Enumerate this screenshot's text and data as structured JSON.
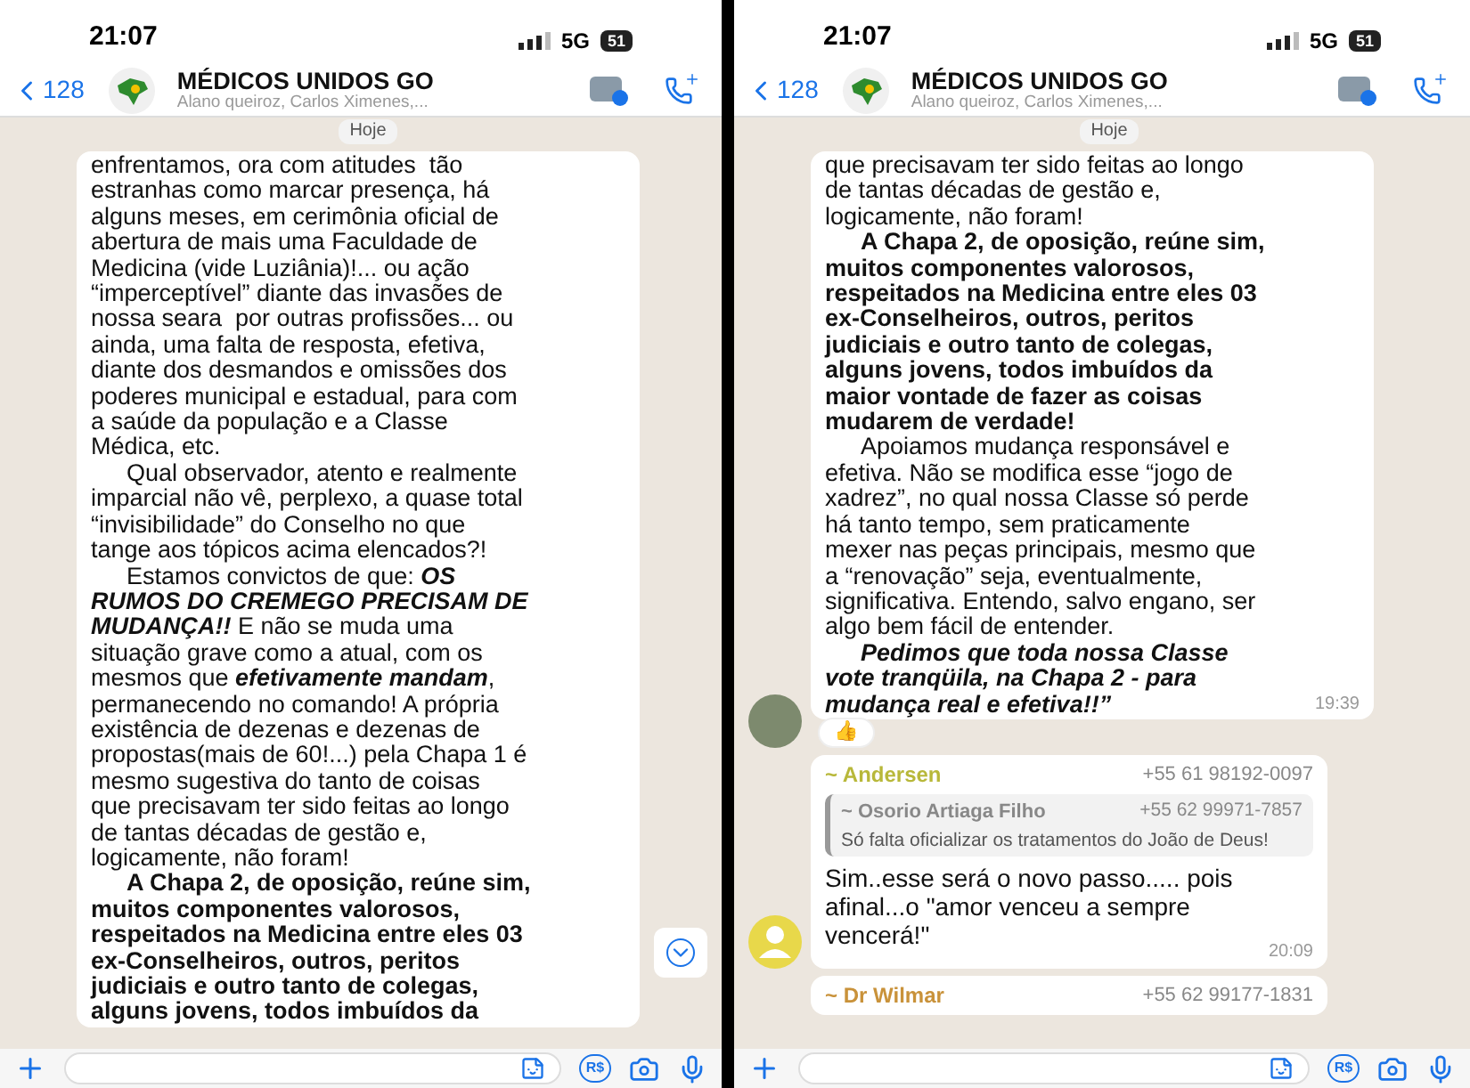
{
  "panels": [
    {
      "status": {
        "time": "21:07",
        "network": "5G",
        "battery": "51"
      },
      "header": {
        "back_count": "128",
        "title": "MÉDICOS UNIDOS GO",
        "subtitle": "Alano queiroz, Carlos Ximenes,..."
      },
      "date_chip": "Hoje",
      "messages": [
        {
          "kind": "long_text",
          "lines": [
            {
              "indent": false,
              "parts": [
                {
                  "text": "enfrentamos, ora com atitudes  tão",
                  "kind": "plain"
                }
              ]
            },
            {
              "indent": false,
              "parts": [
                {
                  "text": "estranhas como marcar presença, há",
                  "kind": "plain"
                }
              ]
            },
            {
              "indent": false,
              "parts": [
                {
                  "text": "alguns meses, em cerimônia oficial de",
                  "kind": "plain"
                }
              ]
            },
            {
              "indent": false,
              "parts": [
                {
                  "text": "abertura de mais uma Faculdade de",
                  "kind": "plain"
                }
              ]
            },
            {
              "indent": false,
              "parts": [
                {
                  "text": "Medicina (vide Luziânia)!... ou ação",
                  "kind": "plain"
                }
              ]
            },
            {
              "indent": false,
              "parts": [
                {
                  "text": "“imperceptível” diante das invasões de",
                  "kind": "plain"
                }
              ]
            },
            {
              "indent": false,
              "parts": [
                {
                  "text": "nossa seara  por outras profissões... ou",
                  "kind": "plain"
                }
              ]
            },
            {
              "indent": false,
              "parts": [
                {
                  "text": "ainda, uma falta de resposta, efetiva,",
                  "kind": "plain"
                }
              ]
            },
            {
              "indent": false,
              "parts": [
                {
                  "text": "diante dos desmandos e omissões dos",
                  "kind": "plain"
                }
              ]
            },
            {
              "indent": false,
              "parts": [
                {
                  "text": "poderes municipal e estadual, para com",
                  "kind": "plain"
                }
              ]
            },
            {
              "indent": false,
              "parts": [
                {
                  "text": "a saúde da população e a Classe",
                  "kind": "plain"
                }
              ]
            },
            {
              "indent": false,
              "parts": [
                {
                  "text": "Médica, etc.",
                  "kind": "plain"
                }
              ]
            },
            {
              "indent": true,
              "parts": [
                {
                  "text": "Qual observador, atento e realmente",
                  "kind": "plain"
                }
              ]
            },
            {
              "indent": false,
              "parts": [
                {
                  "text": "imparcial não vê, perplexo, a quase total",
                  "kind": "plain"
                }
              ]
            },
            {
              "indent": false,
              "parts": [
                {
                  "text": "“invisibilidade” do Conselho no que",
                  "kind": "plain"
                }
              ]
            },
            {
              "indent": false,
              "parts": [
                {
                  "text": "tange aos tópicos acima elencados?!",
                  "kind": "plain"
                }
              ]
            },
            {
              "indent": true,
              "parts": [
                {
                  "text": "Estamos convictos de que: ",
                  "kind": "plain"
                },
                {
                  "text": "OS",
                  "kind": "bold_italic"
                }
              ]
            },
            {
              "indent": false,
              "parts": [
                {
                  "text": "RUMOS DO CREMEGO PRECISAM DE",
                  "kind": "bold_italic"
                }
              ]
            },
            {
              "indent": false,
              "parts": [
                {
                  "text": "MUDANÇA!!",
                  "kind": "bold_italic"
                },
                {
                  "text": " E não se muda uma",
                  "kind": "plain"
                }
              ]
            },
            {
              "indent": false,
              "parts": [
                {
                  "text": "situação grave como a atual, com os",
                  "kind": "plain"
                }
              ]
            },
            {
              "indent": false,
              "parts": [
                {
                  "text": "mesmos que ",
                  "kind": "plain"
                },
                {
                  "text": "efetivamente mandam",
                  "kind": "bold_italic"
                },
                {
                  "text": ",",
                  "kind": "plain"
                }
              ]
            },
            {
              "indent": false,
              "parts": [
                {
                  "text": "permanecendo no comando! A própria",
                  "kind": "plain"
                }
              ]
            },
            {
              "indent": false,
              "parts": [
                {
                  "text": "existência de dezenas e dezenas de",
                  "kind": "plain"
                }
              ]
            },
            {
              "indent": false,
              "parts": [
                {
                  "text": "propostas(mais de 60!...) pela Chapa 1 é",
                  "kind": "plain"
                }
              ]
            },
            {
              "indent": false,
              "parts": [
                {
                  "text": "mesmo sugestiva do tanto de coisas",
                  "kind": "plain"
                }
              ]
            },
            {
              "indent": false,
              "parts": [
                {
                  "text": "que precisavam ter sido feitas ao longo",
                  "kind": "plain"
                }
              ]
            },
            {
              "indent": false,
              "parts": [
                {
                  "text": "de tantas décadas de gestão e,",
                  "kind": "plain"
                }
              ]
            },
            {
              "indent": false,
              "parts": [
                {
                  "text": "logicamente, não foram!",
                  "kind": "plain"
                }
              ]
            },
            {
              "indent": true,
              "parts": [
                {
                  "text": "A Chapa 2, de oposição, reúne sim,",
                  "kind": "bold"
                }
              ]
            },
            {
              "indent": false,
              "parts": [
                {
                  "text": "muitos componentes valorosos,",
                  "kind": "bold"
                }
              ]
            },
            {
              "indent": false,
              "parts": [
                {
                  "text": "respeitados na Medicina entre eles 03",
                  "kind": "bold"
                }
              ]
            },
            {
              "indent": false,
              "parts": [
                {
                  "text": "ex-Conselheiros, outros, peritos",
                  "kind": "bold"
                }
              ]
            },
            {
              "indent": false,
              "parts": [
                {
                  "text": "judiciais e outro tanto de colegas,",
                  "kind": "bold"
                }
              ]
            },
            {
              "indent": false,
              "parts": [
                {
                  "text": "alguns jovens, todos imbuídos da",
                  "kind": "bold"
                }
              ]
            }
          ]
        }
      ],
      "scroll_down_button": true,
      "bottom_bar": {
        "payment_label": "R$"
      }
    },
    {
      "status": {
        "time": "21:07",
        "network": "5G",
        "battery": "51"
      },
      "header": {
        "back_count": "128",
        "title": "MÉDICOS UNIDOS GO",
        "subtitle": "Alano queiroz, Carlos Ximenes,..."
      },
      "date_chip": "Hoje",
      "messages": [
        {
          "kind": "long_text",
          "avatar": {
            "kind": "photo"
          },
          "time": "19:39",
          "reaction": "👍",
          "lines": [
            {
              "indent": false,
              "parts": [
                {
                  "text": "que precisavam ter sido feitas ao longo",
                  "kind": "plain"
                }
              ]
            },
            {
              "indent": false,
              "parts": [
                {
                  "text": "de tantas décadas de gestão e,",
                  "kind": "plain"
                }
              ]
            },
            {
              "indent": false,
              "parts": [
                {
                  "text": "logicamente, não foram!",
                  "kind": "plain"
                }
              ]
            },
            {
              "indent": true,
              "parts": [
                {
                  "text": "A Chapa 2, de oposição, reúne sim,",
                  "kind": "bold"
                }
              ]
            },
            {
              "indent": false,
              "parts": [
                {
                  "text": "muitos componentes valorosos,",
                  "kind": "bold"
                }
              ]
            },
            {
              "indent": false,
              "parts": [
                {
                  "text": "respeitados na Medicina entre eles 03",
                  "kind": "bold"
                }
              ]
            },
            {
              "indent": false,
              "parts": [
                {
                  "text": "ex-Conselheiros, outros, peritos",
                  "kind": "bold"
                }
              ]
            },
            {
              "indent": false,
              "parts": [
                {
                  "text": "judiciais e outro tanto de colegas,",
                  "kind": "bold"
                }
              ]
            },
            {
              "indent": false,
              "parts": [
                {
                  "text": "alguns jovens, todos imbuídos da",
                  "kind": "bold"
                }
              ]
            },
            {
              "indent": false,
              "parts": [
                {
                  "text": "maior vontade de fazer as coisas",
                  "kind": "bold"
                }
              ]
            },
            {
              "indent": false,
              "parts": [
                {
                  "text": "mudarem de verdade!",
                  "kind": "bold"
                }
              ]
            },
            {
              "indent": true,
              "parts": [
                {
                  "text": "Apoiamos mudança responsável e",
                  "kind": "plain"
                }
              ]
            },
            {
              "indent": false,
              "parts": [
                {
                  "text": "efetiva. Não se modifica esse “jogo de",
                  "kind": "plain"
                }
              ]
            },
            {
              "indent": false,
              "parts": [
                {
                  "text": "xadrez”, no qual nossa Classe só perde",
                  "kind": "plain"
                }
              ]
            },
            {
              "indent": false,
              "parts": [
                {
                  "text": "há tanto tempo, sem praticamente",
                  "kind": "plain"
                }
              ]
            },
            {
              "indent": false,
              "parts": [
                {
                  "text": "mexer nas peças principais, mesmo que",
                  "kind": "plain"
                }
              ]
            },
            {
              "indent": false,
              "parts": [
                {
                  "text": "a “renovação” seja, eventualmente,",
                  "kind": "plain"
                }
              ]
            },
            {
              "indent": false,
              "parts": [
                {
                  "text": "significativa. Entendo, salvo engano, ser",
                  "kind": "plain"
                }
              ]
            },
            {
              "indent": false,
              "parts": [
                {
                  "text": "algo bem fácil de entender.",
                  "kind": "plain"
                }
              ]
            },
            {
              "indent": true,
              "parts": [
                {
                  "text": "Pedimos que toda nossa Classe",
                  "kind": "bold_italic"
                }
              ]
            },
            {
              "indent": false,
              "parts": [
                {
                  "text": "vote tranqüila, na Chapa 2 - para",
                  "kind": "bold_italic"
                }
              ]
            },
            {
              "indent": false,
              "parts": [
                {
                  "text": "mudança real e efetiva!!”",
                  "kind": "bold_italic"
                }
              ]
            }
          ]
        },
        {
          "kind": "reply",
          "avatar": {
            "kind": "silhouette"
          },
          "sender": "~ Andersen",
          "color": "#b8b83a",
          "phone": "+55 61 98192-0097",
          "quote": {
            "sender": "~ Osorio Artiaga Filho",
            "phone": "+55 62 99971-7857",
            "text": "Só falta oficializar os tratamentos do João de Deus!"
          },
          "text": "Sim..esse será o novo passo..... pois afinal...o \"amor venceu a sempre vencerá!\"",
          "time": "20:09"
        },
        {
          "kind": "reply",
          "sender": "~ Dr Wilmar",
          "color": "#c9923a",
          "phone": "+55 62 99177-1831"
        }
      ],
      "bottom_bar": {
        "payment_label": "R$"
      }
    }
  ]
}
